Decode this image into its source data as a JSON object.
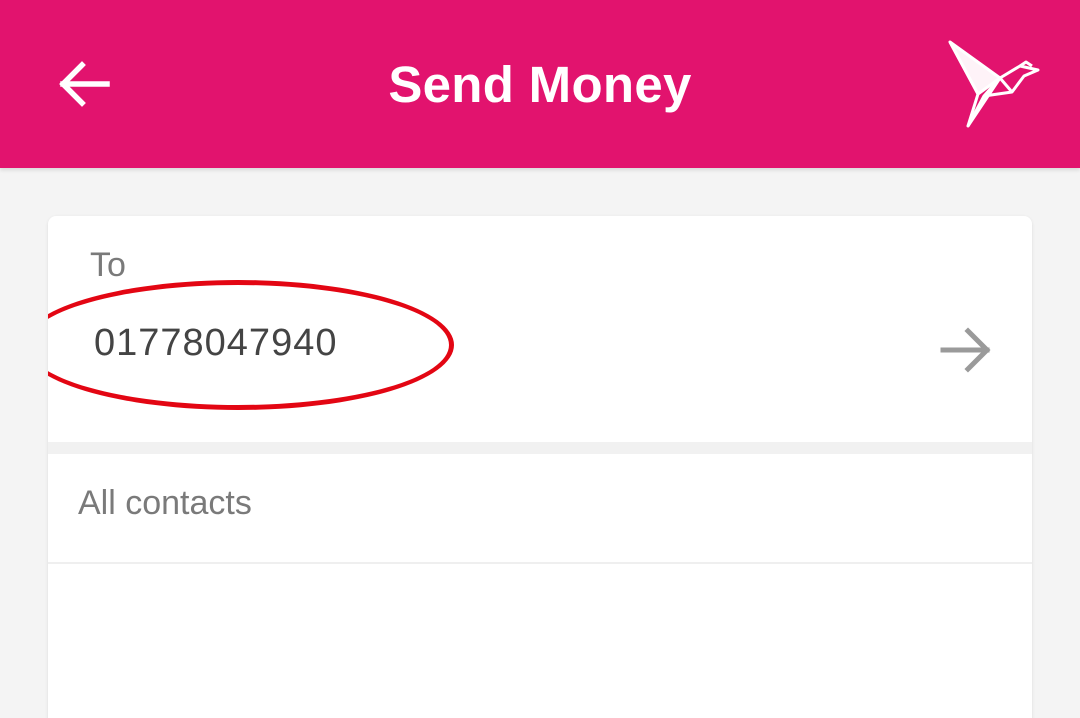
{
  "header": {
    "title": "Send Money",
    "back_icon": "arrow-left-icon",
    "logo_icon": "origami-bird-logo",
    "background_color": "#e2136e"
  },
  "recipient": {
    "label": "To",
    "number": "01778047940",
    "submit_icon": "arrow-right-icon",
    "highlight_color": "#e30613"
  },
  "contacts": {
    "label": "All contacts"
  }
}
